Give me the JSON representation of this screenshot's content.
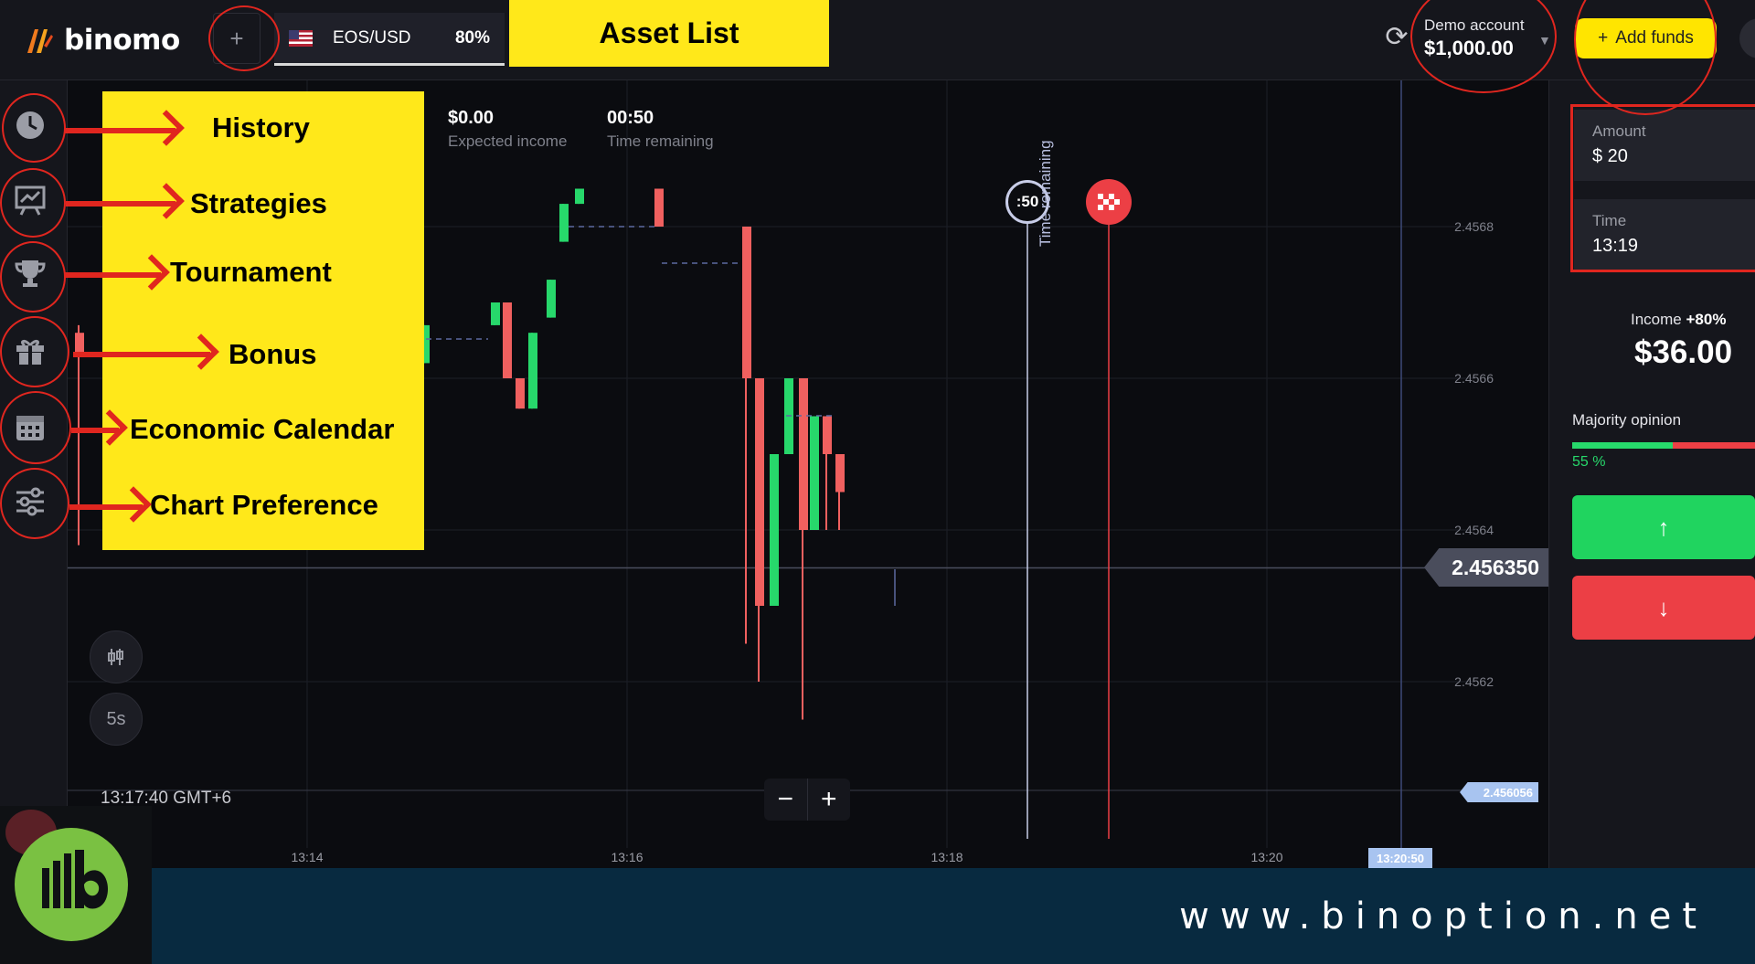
{
  "app": {
    "logo": "binomo"
  },
  "topbar": {
    "add_tab": "+",
    "asset": {
      "symbol": "EOS/USD",
      "payout": "80%"
    },
    "asset_list_annotation": "Asset List",
    "account": {
      "label": "Demo account",
      "balance": "$1,000.00"
    },
    "add_funds": "Add funds"
  },
  "annotations": {
    "items": [
      "History",
      "Strategies",
      "Tournament",
      "Bonus",
      "Economic Calendar",
      "Chart Preference"
    ]
  },
  "trade": {
    "expected_income": {
      "value": "$0.00",
      "label": "Expected income"
    },
    "time_remaining": {
      "value": "00:50",
      "label": "Time remaining"
    },
    "countdown_marker": ":50",
    "vertical_label": "Time remaining"
  },
  "chart_controls": {
    "interval": "5s",
    "clock": "13:17:40 GMT+6",
    "zoom_out": "−",
    "zoom_in": "+"
  },
  "right_panel": {
    "amount": {
      "label": "Amount",
      "value": "$ 20"
    },
    "time": {
      "label": "Time",
      "value": "13:19"
    },
    "income": {
      "label": "Income",
      "pct": "+80%",
      "value": "$36.00"
    },
    "majority": {
      "label": "Majority opinion",
      "pct": "55 %",
      "fraction": 0.55
    },
    "up_icon": "↑",
    "down_icon": "↓"
  },
  "footer": {
    "url": "www.binoption.net"
  },
  "chart_data": {
    "type": "candlestick",
    "current_price": "2.456350",
    "last_price_tag": "2.456056",
    "time_cursor": "13:20:50",
    "y_ticks": [
      "2.4568",
      "2.4566",
      "2.4564",
      "2.4562"
    ],
    "x_ticks": [
      "13:14",
      "13:16",
      "13:18",
      "13:20"
    ],
    "candles": [
      {
        "o": 2.45666,
        "c": 2.45663,
        "h": 2.45667,
        "l": 2.45638
      },
      {
        "o": 2.45651,
        "c": 2.45652,
        "h": 2.45652,
        "l": 2.45651
      },
      {
        "o": 2.45653,
        "c": 2.45651,
        "h": 2.45653,
        "l": 2.45651
      },
      {
        "o": 2.45651,
        "c": 2.45653,
        "h": 2.45653,
        "l": 2.45651
      },
      {
        "o": 2.45662,
        "c": 2.45667,
        "h": 2.45667,
        "l": 2.45662
      },
      {
        "o": 2.45667,
        "c": 2.4567,
        "h": 2.4567,
        "l": 2.45667
      },
      {
        "o": 2.4567,
        "c": 2.4566,
        "h": 2.4567,
        "l": 2.4566
      },
      {
        "o": 2.4566,
        "c": 2.45656,
        "h": 2.4566,
        "l": 2.45656
      },
      {
        "o": 2.45656,
        "c": 2.45666,
        "h": 2.45666,
        "l": 2.45656
      },
      {
        "o": 2.45668,
        "c": 2.45673,
        "h": 2.45673,
        "l": 2.45668
      },
      {
        "o": 2.45678,
        "c": 2.45683,
        "h": 2.45683,
        "l": 2.45678
      },
      {
        "o": 2.45683,
        "c": 2.45685,
        "h": 2.45685,
        "l": 2.45683
      },
      {
        "o": 2.45685,
        "c": 2.4568,
        "h": 2.45685,
        "l": 2.4568
      },
      {
        "o": 2.4568,
        "c": 2.4566,
        "h": 2.4568,
        "l": 2.45625
      },
      {
        "o": 2.4566,
        "c": 2.4563,
        "h": 2.4566,
        "l": 2.4562
      },
      {
        "o": 2.4563,
        "c": 2.4565,
        "h": 2.4565,
        "l": 2.4563
      },
      {
        "o": 2.4565,
        "c": 2.4566,
        "h": 2.4566,
        "l": 2.4565
      },
      {
        "o": 2.4566,
        "c": 2.4564,
        "h": 2.4566,
        "l": 2.45615
      },
      {
        "o": 2.4564,
        "c": 2.45655,
        "h": 2.45655,
        "l": 2.4564
      },
      {
        "o": 2.45655,
        "c": 2.4565,
        "h": 2.45655,
        "l": 2.4564
      },
      {
        "o": 2.4565,
        "c": 2.45645,
        "h": 2.4565,
        "l": 2.4564
      }
    ]
  }
}
